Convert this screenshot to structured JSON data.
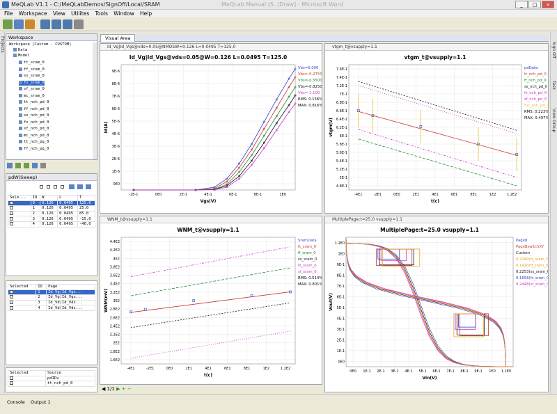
{
  "window": {
    "title": "MeQLab V1.1 - C:/MeQLabDemos/SignOff/Local/SRAM",
    "ghost_title": "MeQLab Manual (S..)Draw] - Microsoft Word",
    "min": "_",
    "max": "□",
    "close": "×"
  },
  "menu": [
    "File",
    "Workspace",
    "View",
    "Utilites",
    "Tools",
    "Window",
    "Help"
  ],
  "left_strip": {
    "label": "Projects"
  },
  "right_strip": {
    "labels": [
      "Sign Off",
      "Task",
      "View Group"
    ]
  },
  "workspace": {
    "title": "Workspace",
    "root": "Workspace [Custom - CUSTOM]",
    "nodes": [
      "Data",
      "Model"
    ],
    "items": [
      "tt_sram_0",
      "ff_sram_0",
      "ss_sram_0",
      "fs_sram_0",
      "sf_sram_0",
      "mc_sram_0",
      "tt_nch_pd_0",
      "ff_nch_pd_0",
      "ss_nch_pd_0",
      "fs_nch_pd_0",
      "sf_nch_pd_0",
      "mc_nch_pd_0",
      "tt_nch_pg_0",
      "ff_nch_pg_0"
    ],
    "selected_index": 3
  },
  "sweep": {
    "title": "pdW(Sweep)",
    "headers": [
      "Sele...",
      "ID",
      "W",
      "L",
      "T"
    ],
    "rows": [
      [
        "0",
        "0.126",
        "0.0495",
        "125.0"
      ],
      [
        "1",
        "0.126",
        "0.0495",
        "25.0"
      ],
      [
        "2",
        "0.126",
        "0.0495",
        "85.0"
      ],
      [
        "3",
        "0.126",
        "0.0495",
        "-15.0"
      ],
      [
        "4",
        "0.126",
        "0.0495",
        "-40.0"
      ]
    ],
    "selected_index": 0
  },
  "pages": {
    "headers": [
      "Selected",
      "ID",
      "Page"
    ],
    "rows": [
      [
        "1",
        "Id_Vg|Id_Vgs..."
      ],
      [
        "2",
        "Id_Vg|Id_Vgs..."
      ],
      [
        "3",
        "Id_Vd|Id_Vds..."
      ],
      [
        "4",
        "Id_Vd|Id_Vds..."
      ]
    ],
    "selected_index": 0
  },
  "sources": {
    "headers": [
      "Selected",
      "Source"
    ],
    "rows": [
      "pdIDv",
      "tt_nch_pd_0"
    ]
  },
  "visual_area": {
    "tab": "Visual Area",
    "pager": "1/1"
  },
  "chart1": {
    "tab": "Id_Vg|Id_Vgs@vds=0.05@NMOSW=0.126 L=0.0495 T=125.0",
    "title": "Id_Vg|Id_Vgs@vds=0.05@W=0.126 L=0.0495 T=125.0",
    "legend": [
      "Vbs=0.000",
      "Vbs=-0.2750",
      "Vbs=-0.5500",
      "Vbs=-0.8250",
      "Vbs=-1.100",
      "RMS: 0.156%",
      "MAX: 0.816%"
    ],
    "legend_colors": [
      "#3344cc",
      "#cc3333",
      "#228833",
      "#111111",
      "#cc33cc"
    ]
  },
  "chart2": {
    "tab": "vtgm_t@vsupply=1.1",
    "title": "vtgm_t@vsupply=1.1",
    "legend": [
      "pdData",
      "tt_nch_pd_0",
      "ff_nch_pd_0",
      "ss_nch_pd_0",
      "fs_nch_pd_0",
      "sf_nch_pd_0",
      "mc_nch_pd_0",
      "RMS: 0.223%",
      "MAX: 0.497%"
    ],
    "legend_colors": [
      "#3344cc",
      "#cc3333",
      "#228833",
      "#111111",
      "#cc33cc",
      "#cc33cc",
      "#e8c020"
    ]
  },
  "chart3": {
    "tab": "WNM_t@vsupply=1.1",
    "title": "WNM_t@vsupply=1.1",
    "legend": [
      "SramData",
      "tt_sram_0",
      "ff_sram_0",
      "ss_sram_0",
      "fs_sram_0",
      "sf_sram_0",
      "RMS: 0.514%",
      "MAX: 0.801%"
    ],
    "legend_colors": [
      "#3344cc",
      "#cc3333",
      "#228833",
      "#111111",
      "#cc33cc",
      "#cc33cc"
    ]
  },
  "chart4": {
    "tab": "MultiplePage:t=25.0 vsupply=1.1",
    "title": "MultiplePage:t=25.0 vsupply=1.1",
    "legend": [
      "Page8",
      "PageBswitchXY",
      "Custom",
      "0.2340(tt_sram_0)",
      "0.1420(ff_sram_0)",
      "0.2253(ss_sram_0)",
      "0.1658(fs_sram_0)",
      "0.2448(sf_sram_0)"
    ],
    "legend_colors": [
      "#3344cc",
      "#cc3333",
      "#111111",
      "#e8a020",
      "#e8a020",
      "#111111",
      "#3344cc",
      "#cc33cc"
    ]
  },
  "chart_data": [
    {
      "type": "line",
      "title": "Id_Vg|Id_Vgs@vds=0.05@W=0.126 L=0.0495 T=125.0",
      "xlabel": "Vgs(V)",
      "ylabel": "Id(A)",
      "xlim": [
        -0.3,
        1.1
      ],
      "ylim": [
        0,
        9e-06
      ],
      "x_ticks": [
        "-2E-1",
        "0E0",
        "2E-1",
        "4E-1",
        "6E-1",
        "8E-1",
        "1E0"
      ],
      "y_ticks": [
        "0E0",
        "1E-6",
        "2E-6",
        "3E-6",
        "4E-6",
        "5E-6",
        "6E-6",
        "7E-6",
        "8E-6",
        "9E-6"
      ],
      "x": [
        -0.2,
        0.3,
        0.45,
        0.55,
        0.65,
        0.75,
        0.85,
        0.95,
        1.05,
        1.1
      ],
      "series": [
        {
          "name": "Vbs=0.000",
          "values": [
            0,
            0,
            2e-07,
            8e-07,
            1.9e-06,
            3.3e-06,
            4.9e-06,
            6.5e-06,
            8e-06,
            8.7e-06
          ]
        },
        {
          "name": "Vbs=-0.2750",
          "values": [
            0,
            0,
            1e-07,
            6e-07,
            1.6e-06,
            2.9e-06,
            4.4e-06,
            5.9e-06,
            7.4e-06,
            8.1e-06
          ]
        },
        {
          "name": "Vbs=-0.5500",
          "values": [
            0,
            0,
            5e-08,
            4e-07,
            1.3e-06,
            2.5e-06,
            3.9e-06,
            5.3e-06,
            6.7e-06,
            7.4e-06
          ]
        },
        {
          "name": "Vbs=-0.8250",
          "values": [
            0,
            0,
            3e-08,
            3e-07,
            1e-06,
            2.1e-06,
            3.4e-06,
            4.8e-06,
            6.1e-06,
            6.8e-06
          ]
        },
        {
          "name": "Vbs=-1.100",
          "values": [
            0,
            0,
            2e-08,
            2e-07,
            8e-07,
            1.8e-06,
            3e-06,
            4.3e-06,
            5.6e-06,
            6.2e-06
          ]
        }
      ]
    },
    {
      "type": "line",
      "title": "vtgm_t@vsupply=1.1",
      "xlabel": "t(c)",
      "ylabel": "vtgm(V)",
      "xlim": [
        -50,
        130
      ],
      "ylim": [
        0.47,
        0.77
      ],
      "x_ticks": [
        "-4E1",
        "-2E1",
        "0E0",
        "2E1",
        "4E1",
        "6E1",
        "8E1",
        "1E2",
        "1.2E2"
      ],
      "y_ticks": [
        "4.8E-1",
        "5E-1",
        "5.2E-1",
        "5.4E-1",
        "5.6E-1",
        "5.8E-1",
        "6E-1",
        "6.2E-1",
        "6.4E-1",
        "6.6E-1",
        "6.8E-1",
        "7E-1",
        "7.2E-1",
        "7.4E-1",
        "7.6E-1"
      ],
      "x": [
        -40,
        125
      ],
      "series": [
        {
          "name": "tt_nch_pd_0",
          "values": [
            0.658,
            0.553
          ]
        },
        {
          "name": "ff_nch_pd_0",
          "values": [
            0.592,
            0.48
          ]
        },
        {
          "name": "ss_nch_pd_0",
          "values": [
            0.73,
            0.613
          ]
        },
        {
          "name": "fs_nch_pd_0",
          "values": [
            0.615,
            0.5
          ]
        },
        {
          "name": "sf_nch_pd_0",
          "values": [
            0.72,
            0.605
          ]
        }
      ],
      "points": {
        "name": "pdData",
        "x": [
          -40,
          -25,
          25,
          85,
          125
        ],
        "y": [
          0.66,
          0.648,
          0.622,
          0.58,
          0.555
        ]
      }
    },
    {
      "type": "line",
      "title": "WNM_t@vsupply=1.1",
      "xlabel": "t(c)",
      "ylabel": "WNM(mV)",
      "xlim": [
        -50,
        130
      ],
      "ylim": [
        160,
        450
      ],
      "x_ticks": [
        "-4E1",
        "-2E1",
        "0E0",
        "2E1",
        "4E1",
        "6E1",
        "8E1",
        "1E2",
        "1.2E2"
      ],
      "y_ticks": [
        "1.6E2",
        "1.8E2",
        "2E2",
        "2.2E2",
        "2.4E2",
        "2.6E2",
        "2.8E2",
        "3E2",
        "3.2E2",
        "3.4E2",
        "3.6E2",
        "3.8E2",
        "4E2",
        "4.2E2",
        "4.4E2"
      ],
      "x": [
        -40,
        125
      ],
      "series": [
        {
          "name": "tt_sram_0",
          "values": [
            278,
            325
          ]
        },
        {
          "name": "ff_sram_0",
          "values": [
            316,
            380
          ]
        },
        {
          "name": "ss_sram_0",
          "values": [
            243,
            300
          ]
        },
        {
          "name": "fs_sram_0",
          "values": [
            360,
            428
          ]
        },
        {
          "name": "sf_sram_0",
          "values": [
            173,
            235
          ]
        }
      ],
      "points": {
        "name": "SramData",
        "x": [
          -40,
          -25,
          25,
          85,
          125
        ],
        "y": [
          279,
          285,
          305,
          316,
          325
        ]
      }
    },
    {
      "type": "line",
      "title": "MultiplePage:t=25.0 vsupply=1.1",
      "xlabel": "Vin(V)",
      "ylabel": "Vout(V)",
      "xlim": [
        0,
        1.1
      ],
      "ylim": [
        0,
        1.1
      ],
      "x_ticks": [
        "0E0",
        "1E-1",
        "2E-1",
        "3E-1",
        "4E-1",
        "5E-1",
        "6E-1",
        "7E-1",
        "8E-1",
        "9E-1",
        "1E0",
        "1.1E0"
      ],
      "y_ticks": [
        "0E0",
        "1E-1",
        "2E-1",
        "3E-1",
        "4E-1",
        "5E-1",
        "6E-1",
        "7E-1",
        "8E-1",
        "9E-1",
        "1E0",
        "1.1E0"
      ],
      "series": [
        {
          "name": "tt_sram_0",
          "values": [
            0.234
          ]
        },
        {
          "name": "ff_sram_0",
          "values": [
            0.142
          ]
        },
        {
          "name": "ss_sram_0",
          "values": [
            0.2253
          ]
        },
        {
          "name": "fs_sram_0",
          "values": [
            0.1658
          ]
        },
        {
          "name": "sf_sram_0",
          "values": [
            0.2448
          ]
        }
      ]
    }
  ]
}
